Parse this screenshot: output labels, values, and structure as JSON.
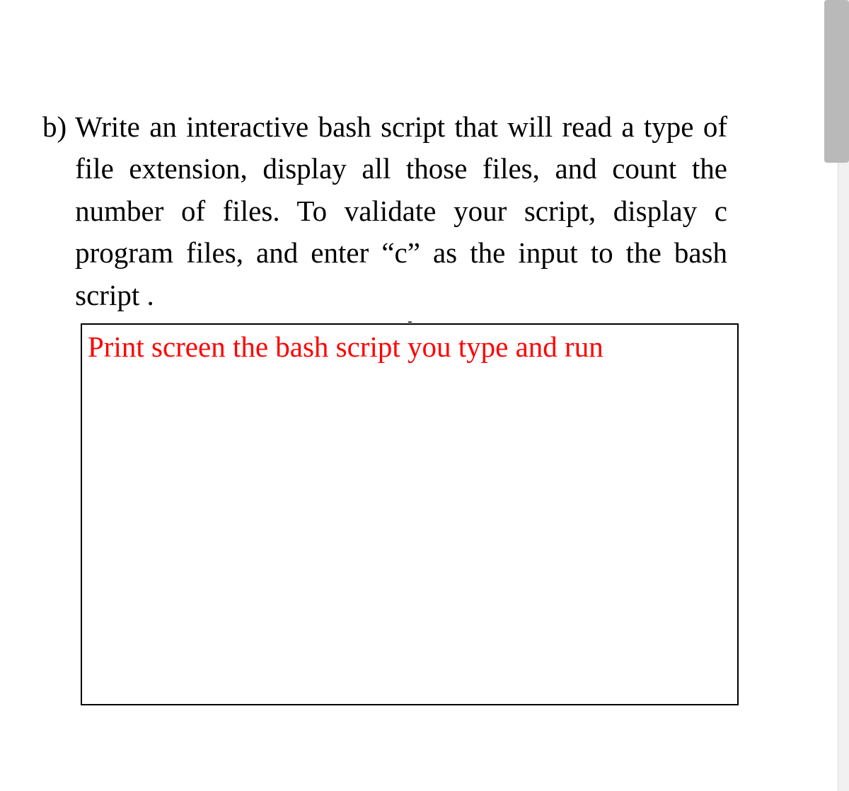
{
  "question": {
    "label": "b)",
    "text": "Write an interactive bash script that will read a type of file extension, display all those files, and count the number of files. To validate your script, display c program files, and enter “c” as the input to the bash script ."
  },
  "instruction": {
    "text": "Print screen the bash script you type and run"
  },
  "dash": "-",
  "colors": {
    "text_black": "#000000",
    "instruction_red": "#ff0000",
    "scroll_thumb": "#b9b9b9"
  }
}
